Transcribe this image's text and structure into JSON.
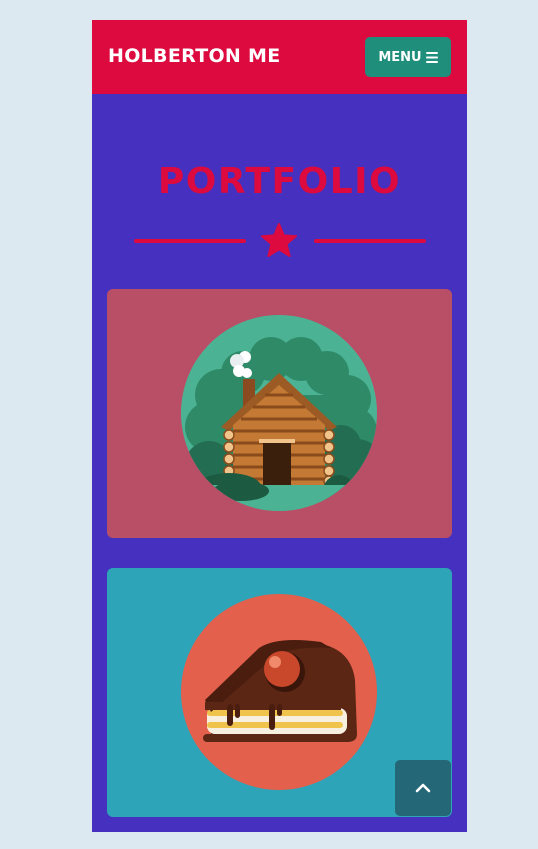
{
  "navbar": {
    "brand": "HOLBERTON ME",
    "menu_label": "MENU",
    "menu_icon": "bars-icon"
  },
  "portfolio": {
    "title": "PORTFOLIO",
    "divider_icon": "star-icon",
    "items": [
      {
        "image": "log-cabin",
        "background": "#b84f66"
      },
      {
        "image": "cake-slice",
        "background": "#2da4b8"
      }
    ]
  },
  "scroll_top": {
    "icon": "chevron-up-icon"
  },
  "colors": {
    "page_background": "#dde9f0",
    "content_background": "#4530bf",
    "navbar": "#dc0a3e",
    "accent": "#dc0a3e",
    "menu_button": "#1f8f7c",
    "scroll_top_button": "#246878"
  }
}
